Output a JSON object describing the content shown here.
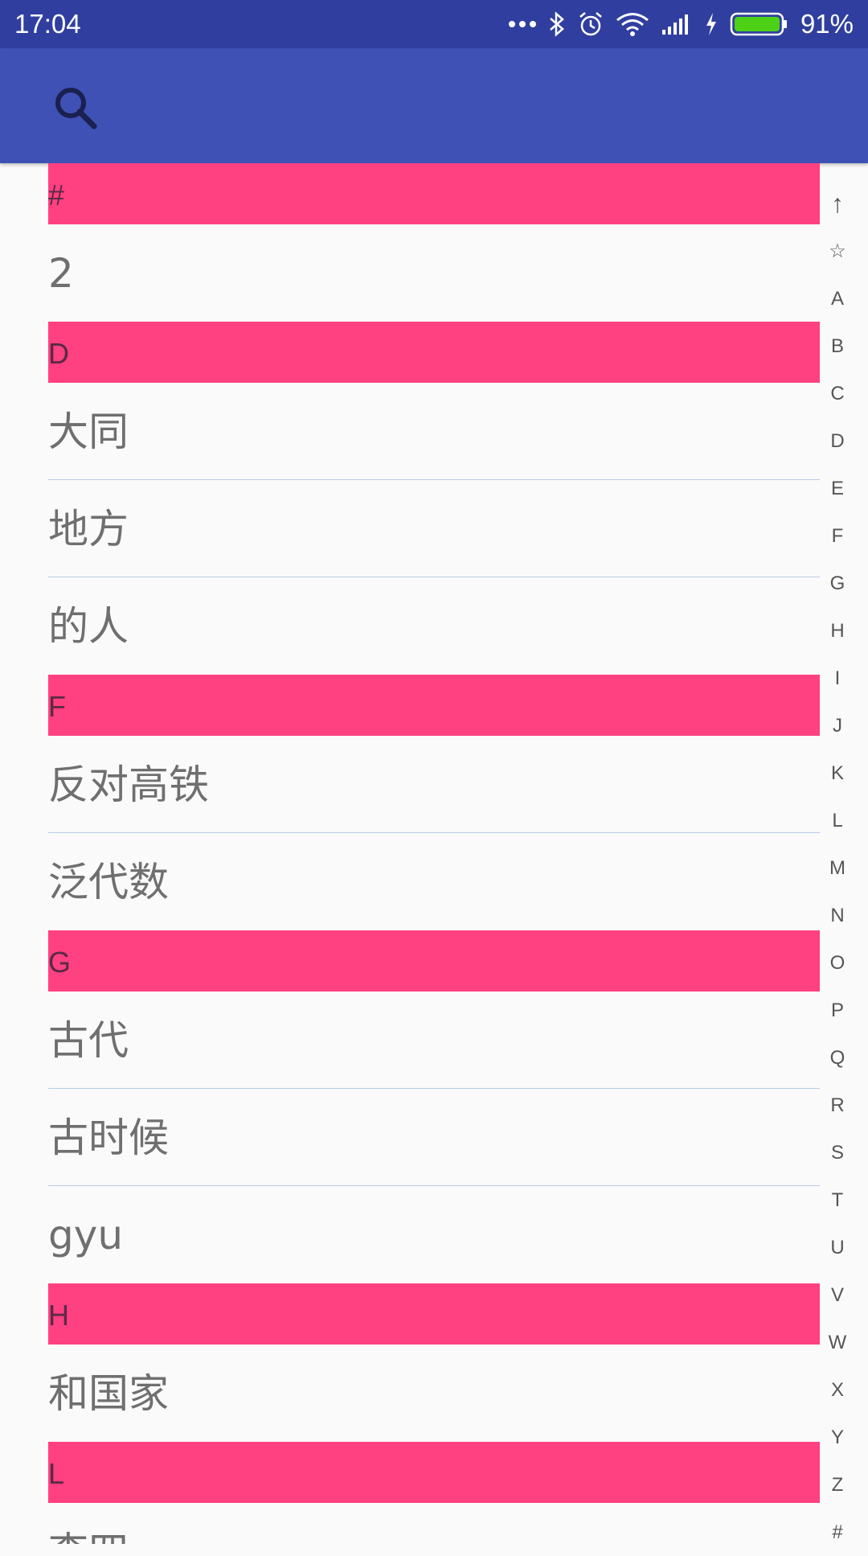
{
  "status_bar": {
    "time": "17:04",
    "battery": "91%",
    "icons": [
      "more-dots-icon",
      "bluetooth-icon",
      "alarm-icon",
      "wifi-icon",
      "signal-icon",
      "charging-icon",
      "battery-icon"
    ]
  },
  "toolbar": {
    "search_icon": "search-icon",
    "color": "#3f51b5"
  },
  "colors": {
    "status_bar": "#303f9f",
    "section_header": "#ff4081",
    "battery_fill": "#4cd117"
  },
  "list": [
    {
      "type": "header",
      "label": "#"
    },
    {
      "type": "item",
      "label": "2"
    },
    {
      "type": "header",
      "label": "D"
    },
    {
      "type": "item",
      "label": "大同"
    },
    {
      "type": "item",
      "label": "地方"
    },
    {
      "type": "item",
      "label": "的人"
    },
    {
      "type": "header",
      "label": "F"
    },
    {
      "type": "item",
      "label": "反对高铁"
    },
    {
      "type": "item",
      "label": "泛代数"
    },
    {
      "type": "header",
      "label": "G"
    },
    {
      "type": "item",
      "label": "古代"
    },
    {
      "type": "item",
      "label": "古时候"
    },
    {
      "type": "item",
      "label": "gyu"
    },
    {
      "type": "header",
      "label": "H"
    },
    {
      "type": "item",
      "label": "和国家"
    },
    {
      "type": "header",
      "label": "L"
    },
    {
      "type": "item",
      "label": "李四"
    }
  ],
  "index_bar": [
    "↑",
    "☆",
    "A",
    "B",
    "C",
    "D",
    "E",
    "F",
    "G",
    "H",
    "I",
    "J",
    "K",
    "L",
    "M",
    "N",
    "O",
    "P",
    "Q",
    "R",
    "S",
    "T",
    "U",
    "V",
    "W",
    "X",
    "Y",
    "Z",
    "#"
  ]
}
